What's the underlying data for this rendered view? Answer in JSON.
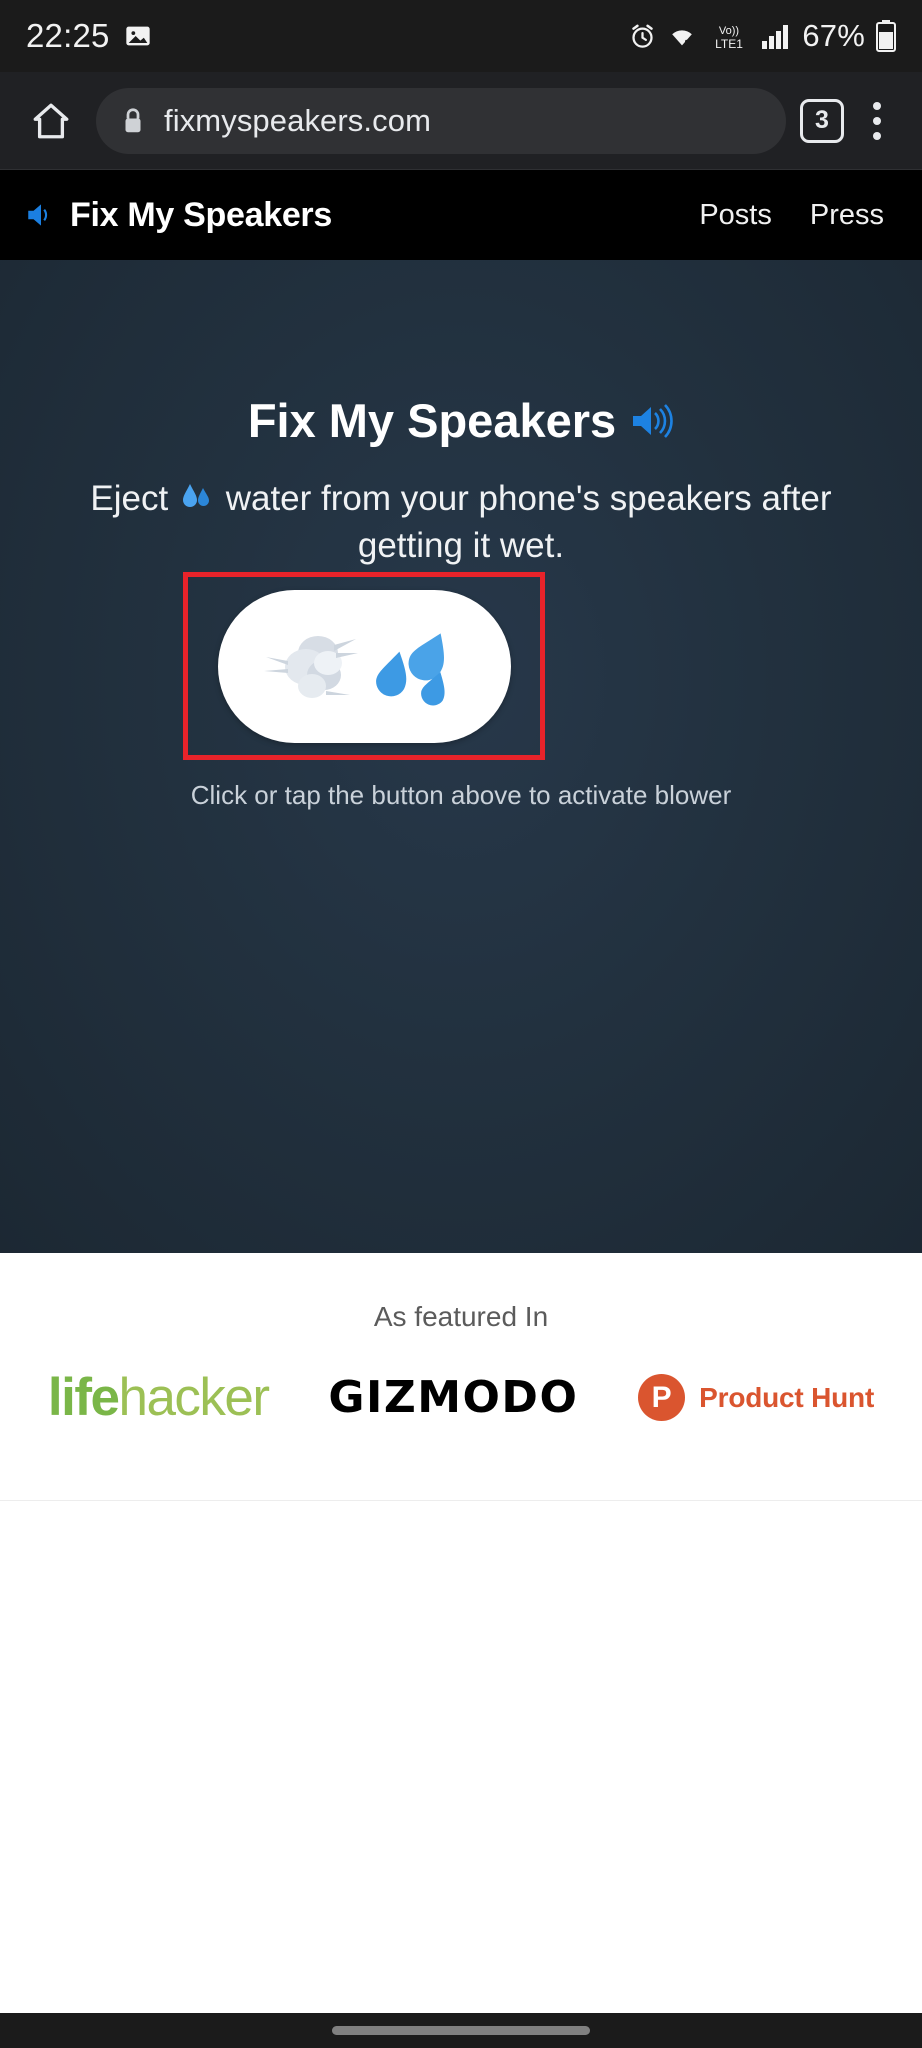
{
  "statusbar": {
    "time": "22:25",
    "battery": "67%",
    "network_label": "LTE1",
    "volte_label": "Vo)",
    "icons": [
      "image-icon",
      "alarm-icon",
      "wifi-icon",
      "volte-icon",
      "signal-icon",
      "battery-icon"
    ]
  },
  "browser": {
    "home_icon": "home-icon",
    "lock_icon": "lock-icon",
    "url": "fixmyspeakers.com",
    "tab_count": "3",
    "menu_icon": "overflow-menu-icon"
  },
  "site_header": {
    "logo_icon": "speaker-icon",
    "brand": "Fix My Speakers",
    "nav": [
      {
        "label": "Posts"
      },
      {
        "label": "Press"
      }
    ]
  },
  "hero": {
    "title": "Fix My Speakers",
    "title_icon": "loud-speaker-emoji",
    "subtitle_part1": "Eject",
    "subtitle_emoji": "water-droplets-emoji",
    "subtitle_part2": "water from your phone's speakers after getting it wet.",
    "button": {
      "name": "blower-button",
      "icon_left": "dashing-away-emoji",
      "icon_right": "sweat-droplets-emoji",
      "highlight_color": "#e8232a"
    },
    "caption": "Click or tap the button above to activate blower",
    "background_color": "#22313f"
  },
  "featured": {
    "title": "As featured In",
    "logos": [
      {
        "name": "lifehacker-logo",
        "text_bold": "life",
        "text_light": "hacker",
        "color": "#7ab648"
      },
      {
        "name": "gizmodo-logo",
        "text": "GIZMODO",
        "color": "#000000"
      },
      {
        "name": "product-hunt-logo",
        "badge": "P",
        "text": "Product Hunt",
        "color": "#da552f"
      }
    ]
  },
  "gesture_bar": {
    "handle": "gesture-handle"
  }
}
